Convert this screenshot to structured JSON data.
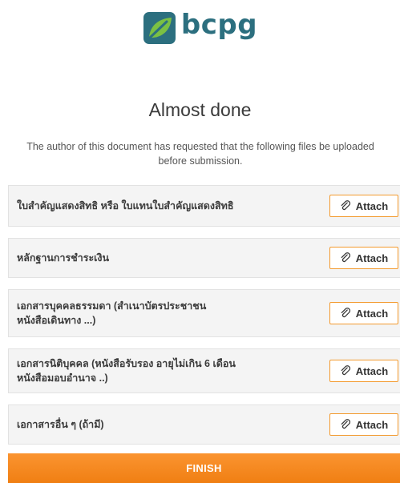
{
  "brand": {
    "logo_text": "bcpg",
    "logo_icon": "leaf-logo-icon",
    "color": "#2c6f7f"
  },
  "heading": {
    "title": "Almost done",
    "subtitle": "The author of this document has requested that the following files be uploaded before submission."
  },
  "attachments": [
    {
      "label": "ใบสำคัญแสดงสิทธิ หรือ ใบแทนใบสำคัญแสดงสิทธิ",
      "button": "Attach"
    },
    {
      "label": "หลักฐานการชำระเงิน",
      "button": "Attach"
    },
    {
      "label": "เอกสารบุคคลธรรมดา (สำเนาบัตรประชาชน\nหนังสือเดินทาง ...)",
      "button": "Attach"
    },
    {
      "label": "เอกสารนิติบุคคล (หนังสือรับรอง อายุไม่เกิน 6 เดือน\nหนังสือมอบอำนาจ ..)",
      "button": "Attach"
    },
    {
      "label": "เอกาสารอื่น ๆ (ถ้ามี)",
      "button": "Attach"
    }
  ],
  "attach_icon": "paperclip-icon",
  "finish_label": "FINISH",
  "colors": {
    "accent": "#f39a2e",
    "finish": "#f5871d",
    "row_bg": "#f4f4f4"
  }
}
